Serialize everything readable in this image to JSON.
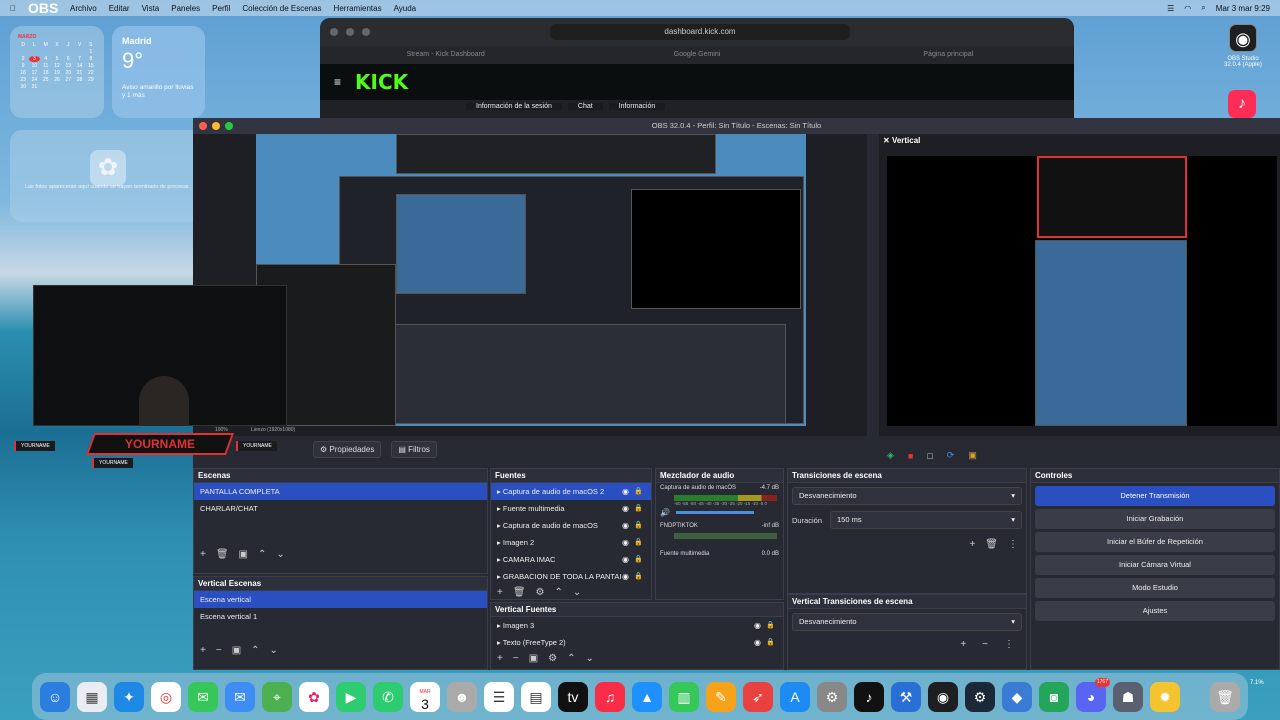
{
  "menubar": {
    "app_name": "OBS",
    "menus": [
      "Archivo",
      "Editar",
      "Vista",
      "Paneles",
      "Perfil",
      "Colección de Escenas",
      "Herramientas",
      "Ayuda"
    ],
    "clock": "Mar 3 mar 9:29"
  },
  "calendar": {
    "month": "MARZO",
    "weekdays": [
      "D",
      "L",
      "M",
      "X",
      "J",
      "V",
      "S"
    ],
    "days": [
      "",
      "",
      "",
      "",
      "",
      "",
      "1",
      "2",
      "3",
      "4",
      "5",
      "6",
      "7",
      "8",
      "9",
      "10",
      "11",
      "12",
      "13",
      "14",
      "15",
      "16",
      "17",
      "18",
      "19",
      "20",
      "21",
      "22",
      "23",
      "24",
      "25",
      "26",
      "27",
      "28",
      "29",
      "30",
      "31"
    ],
    "today": "3"
  },
  "weather": {
    "city": "Madrid",
    "temp": "9°",
    "desc": "Aviso amarillo por lluvias y 1 más"
  },
  "photos_widget": {
    "text": "Las fotos aparecerán aquí cuando se hayan terminado de procesar."
  },
  "browser": {
    "url": "dashboard.kick.com",
    "tabs": [
      "Stream - Kick Dashboard",
      "Google Gemini",
      "Página principal"
    ],
    "logo": "KICK",
    "panels": [
      "Información de la sesión",
      "Chat",
      "Información"
    ]
  },
  "desktop_icons": {
    "obs_label": "OBS Studio 32.0.4 (Apple)"
  },
  "obs": {
    "window_title": "OBS 32.0.4 - Perfil: Sin Título - Escenas: Sin Título",
    "vertical_title": "Vertical",
    "tabs": {
      "properties": "Propiedades",
      "filters": "Filtros"
    },
    "canvas_label": "Lienzo (1920x1080)",
    "zoom": "100%",
    "scenes": {
      "title": "Escenas",
      "items": [
        "PANTALLA COMPLETA",
        "CHARLAR/CHAT"
      ]
    },
    "vertical_scenes": {
      "title": "Vertical Escenas",
      "items": [
        "Escena vertical",
        "Escena vertical 1"
      ]
    },
    "sources": {
      "title": "Fuentes",
      "items": [
        "Captura de audio de macOS 2",
        "Fuente multimedia",
        "Captura de audio de macOS",
        "Imagen 2",
        "CAMARA IMAC",
        "GRABACION DE TODA LA PANTAI"
      ]
    },
    "vertical_sources": {
      "title": "Vertical Fuentes",
      "items": [
        "Imagen 3",
        "Texto (FreeType 2)"
      ]
    },
    "mixer": {
      "title": "Mezclador de audio",
      "channels": [
        {
          "name": "Captura de audio de macOS",
          "db": "-4.7 dB"
        },
        {
          "name": "FNDPTIKTOK",
          "db": "-inf dB"
        },
        {
          "name": "Fuente multimedia",
          "db": "0.0 dB"
        }
      ],
      "scale": "-60 -55 -50 -45 -40 -35 -30 -25 -20 -15 -10 -5 0"
    },
    "transitions": {
      "title": "Transiciones de escena",
      "type": "Desvanecimiento",
      "duration_label": "Duración",
      "duration": "150 ms"
    },
    "vertical_transitions": {
      "title": "Vertical Transiciones de escena",
      "type": "Desvanecimiento"
    },
    "controls": {
      "title": "Controles",
      "buttons": [
        "Detener Transmisión",
        "Iniciar Grabación",
        "Iniciar el Búfer de Repetición",
        "Iniciar Cámara Virtual",
        "Modo Estudio",
        "Ajustes"
      ]
    }
  },
  "overlay": {
    "yourname": "YOURNAME",
    "small1": "YOURNAME",
    "small2": "YOURNAME",
    "small3": "YOURNAME"
  },
  "dock": {
    "badge": "1767",
    "date_day": "3",
    "date_month": "MAR",
    "battery": "7.1%"
  },
  "colors": {
    "accent": "#2a4fc1",
    "kick_green": "#53fc18",
    "overlay_red": "#e03232"
  }
}
